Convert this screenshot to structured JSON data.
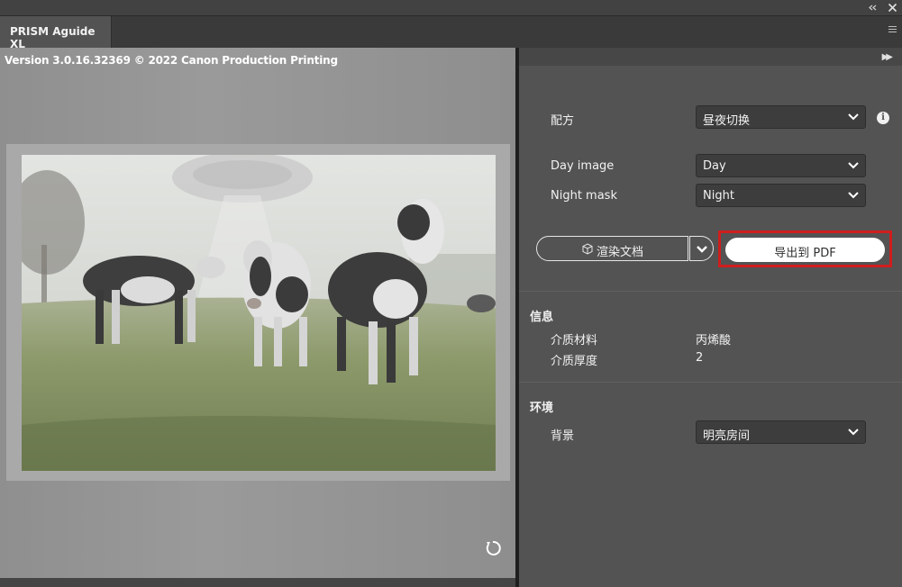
{
  "window": {
    "collapse_icon": "double-chevron-left-icon",
    "close_icon": "close-icon"
  },
  "tab": {
    "title": "PRISM Aguide XL",
    "menu_icon": "hamburger-menu-icon"
  },
  "preview": {
    "version_text": "Version 3.0.16.32369 © 2022 Canon Production Printing",
    "image_description_icon": "cows-in-field-photo",
    "refresh_icon": "refresh-icon"
  },
  "panel": {
    "expand_icon": "double-chevron-right-icon",
    "recipe": {
      "label": "配方",
      "value": "昼夜切换",
      "info_icon": "info-icon"
    },
    "day_image": {
      "label": "Day image",
      "value": "Day"
    },
    "night_mask": {
      "label": "Night mask",
      "value": "Night"
    },
    "render_button": {
      "label": "渲染文档",
      "icon": "cube-icon"
    },
    "render_more_icon": "chevron-down-icon",
    "export_button": {
      "label": "导出到 PDF"
    },
    "info_section": {
      "title": "信息",
      "rows": [
        {
          "label": "介质材料",
          "value": "丙烯酸"
        },
        {
          "label": "介质厚度",
          "value": "2"
        }
      ]
    },
    "environment_section": {
      "title": "环境",
      "background": {
        "label": "背景",
        "value": "明亮房间"
      }
    }
  },
  "colors": {
    "highlight_border": "#d01d1d",
    "panel_bg": "#535353",
    "dropdown_bg": "#3d3d3d"
  }
}
